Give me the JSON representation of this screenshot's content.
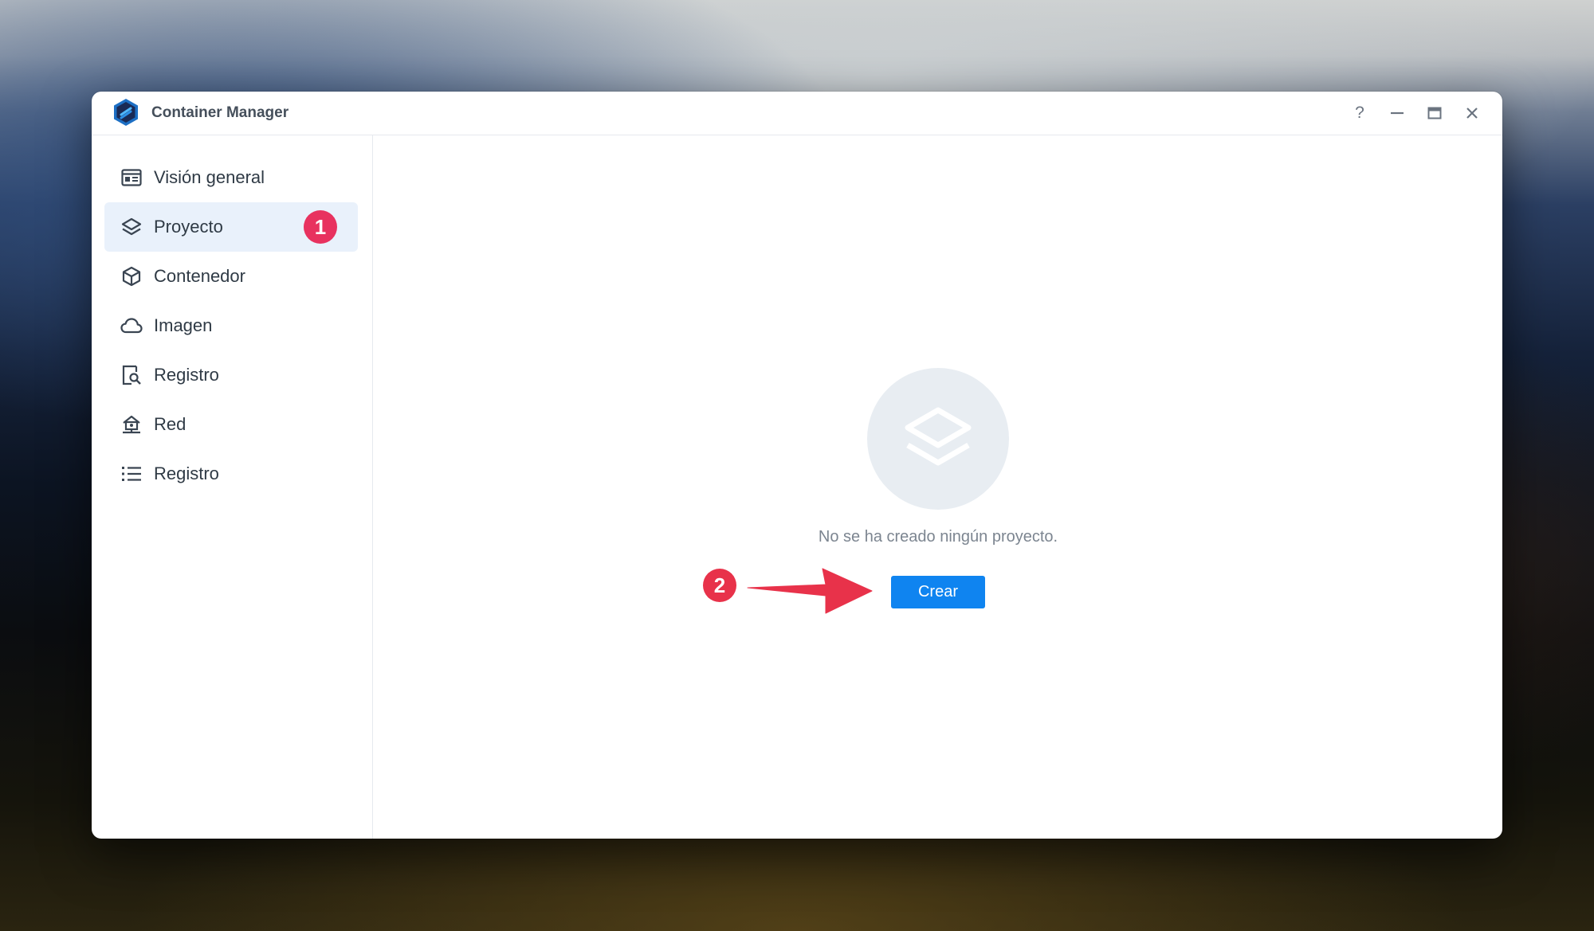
{
  "window": {
    "title": "Container Manager",
    "controls": {
      "help": "?",
      "minimize_icon": "minimize-icon",
      "maximize_icon": "maximize-icon",
      "close_icon": "close-icon"
    }
  },
  "sidebar": {
    "items": [
      {
        "label": "Visión general",
        "icon": "overview-icon",
        "active": false
      },
      {
        "label": "Proyecto",
        "icon": "layers-icon",
        "active": true
      },
      {
        "label": "Contenedor",
        "icon": "cube-icon",
        "active": false
      },
      {
        "label": "Imagen",
        "icon": "cloud-icon",
        "active": false
      },
      {
        "label": "Registro",
        "icon": "document-search-icon",
        "active": false
      },
      {
        "label": "Red",
        "icon": "network-icon",
        "active": false
      },
      {
        "label": "Registro",
        "icon": "list-icon",
        "active": false
      }
    ]
  },
  "main": {
    "empty_state": {
      "icon": "layers-icon",
      "message": "No se ha creado ningún proyecto.",
      "create_label": "Crear"
    }
  },
  "annotations": {
    "step_1": "1",
    "step_2": "2"
  },
  "colors": {
    "accent": "#0f84f0",
    "active_item_bg": "#e9f1fb",
    "step_badge": "#e8325f",
    "arrow": "#e8324a"
  }
}
